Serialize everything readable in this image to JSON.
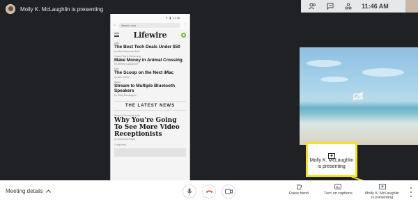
{
  "header": {
    "presenting_text": "Molly K. McLaughlin is presenting",
    "clock": "11:46 AM",
    "icons": [
      "people-icon",
      "chat-icon",
      "activities-icon"
    ]
  },
  "shared_screen": {
    "url": "lifewire.com",
    "brand": "Lifewire",
    "articles": [
      {
        "category": "Gifts",
        "headline": "The Best Tech Deals Under $50",
        "byline": "by Alice Newcome-Beill"
      },
      {
        "category": "Game Play & Streaming",
        "headline": "Make Money in Animal Crossing",
        "byline": "by Jeremy Laukkonen"
      },
      {
        "category": "Mac",
        "headline": "The Scoop on the Next iMac",
        "byline": "by Ben Fisher"
      },
      {
        "category": "Audio",
        "headline": "Stream to Multiple Bluetooth Speakers",
        "byline": "by Molly McLaughlin"
      }
    ],
    "section_title": "THE LATEST NEWS",
    "featured": {
      "category": "Smart & Connected Life",
      "headline": "Why You're Going To See More Video Receptionists",
      "byline": "by Sascha Brodsky"
    },
    "footer_category": "Computers"
  },
  "callout": {
    "text": "Molly K. McLaughlin\nis presenting",
    "accent": "#f2e12f"
  },
  "bottom_bar": {
    "meeting_details": "Meeting details",
    "raise_hand": "Raise hand",
    "captions": "Turn on captions",
    "presenting": "Molly K. McLaughlin\nis presenting",
    "end_call_color": "#d93025"
  }
}
